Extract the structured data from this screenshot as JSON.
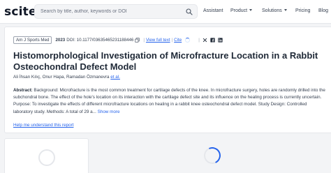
{
  "header": {
    "logo": "scite_",
    "search_placeholder": "Search by title, author, keywords or DOI",
    "nav": {
      "assistant": "Assistant",
      "product": "Product",
      "solutions": "Solutions",
      "pricing": "Pricing",
      "blog": "Blog"
    }
  },
  "paper": {
    "journal": "Am J Sports Med",
    "year": "2023",
    "doi": "DOI: 10.1177/03635465231188446",
    "view_full_text": "View full text",
    "cite": "Cite",
    "title": "Histomorphological Investigation of Microfracture Location in a Rabbit Osteochondral Defect Model",
    "authors": "Ali İhsan Kılıç, Onur Hapa, Ramadan Özmanevra",
    "et_al": "et al.",
    "abstract_label": "Abstract:",
    "abstract_text": "Background: Microfracture is the most common treatment for cartilage defects of the knee. In microfracture surgery, holes are randomly drilled into the subchondral bone. The effect of the hole's location on its interaction with the cartilage defect site and its influence on the healing process is currently uncertain. Purpose: To investigate the effects of different microfracture locations on healing in a rabbit knee osteochondral defect model. Study Design: Controlled laboratory study. Methods: A total of 29 a...",
    "show_more": "Show more",
    "help_link": "Help me understand this report"
  },
  "icons": {
    "search": "search-icon",
    "copy": "copy-icon",
    "twitter": "twitter-icon",
    "facebook": "facebook-icon",
    "linkedin": "linkedin-icon"
  },
  "colors": {
    "accent": "#2563eb",
    "text": "#1f2937",
    "background": "#f3f4f6"
  }
}
